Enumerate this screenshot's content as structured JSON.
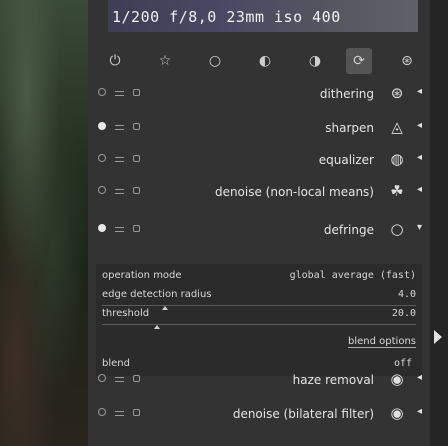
{
  "histogram": {
    "exif": "1/200 f/8,0 23mm iso 400"
  },
  "group_tabs": [
    {
      "icon": "power-icon",
      "glyph": "⏻"
    },
    {
      "icon": "star-icon",
      "glyph": "☆"
    },
    {
      "icon": "circle-icon",
      "glyph": "○"
    },
    {
      "icon": "tone-icon",
      "glyph": "◐"
    },
    {
      "icon": "color-icon",
      "glyph": "◑"
    },
    {
      "icon": "correct-icon",
      "glyph": "⟳"
    },
    {
      "icon": "effect-icon",
      "glyph": "⊛"
    }
  ],
  "modules": [
    {
      "name": "dithering",
      "icon": "dithering-icon",
      "glyph": "⊛",
      "enabled": false,
      "arrow": "◂"
    },
    {
      "name": "sharpen",
      "icon": "sharpen-icon",
      "glyph": "◬",
      "enabled": true,
      "arrow": "◂"
    },
    {
      "name": "equalizer",
      "icon": "equalizer-icon",
      "glyph": "◍",
      "enabled": false,
      "arrow": "◂"
    },
    {
      "name": "denoise (non-local means)",
      "icon": "denoise-nlm-icon",
      "glyph": "☘",
      "enabled": false,
      "arrow": "◂"
    },
    {
      "name": "defringe",
      "icon": "defringe-icon",
      "glyph": "○",
      "enabled": true,
      "arrow": "▾"
    },
    {
      "name": "haze removal",
      "icon": "haze-icon",
      "glyph": "◉",
      "enabled": false,
      "arrow": "◂"
    },
    {
      "name": "denoise (bilateral filter)",
      "icon": "denoise-bilateral-icon",
      "glyph": "◉",
      "enabled": false,
      "arrow": "◂"
    }
  ],
  "defringe": {
    "operation_label": "operation mode",
    "operation_value": "global average (fast)",
    "edge_label": "edge detection radius",
    "edge_value": "4.0",
    "threshold_label": "threshold",
    "threshold_value": "20.0",
    "blend_options": "blend options",
    "blend_label": "blend",
    "blend_value": "off"
  },
  "colors": {
    "panel": "#333333",
    "text": "#e4e4e4",
    "accent": "#555555"
  }
}
